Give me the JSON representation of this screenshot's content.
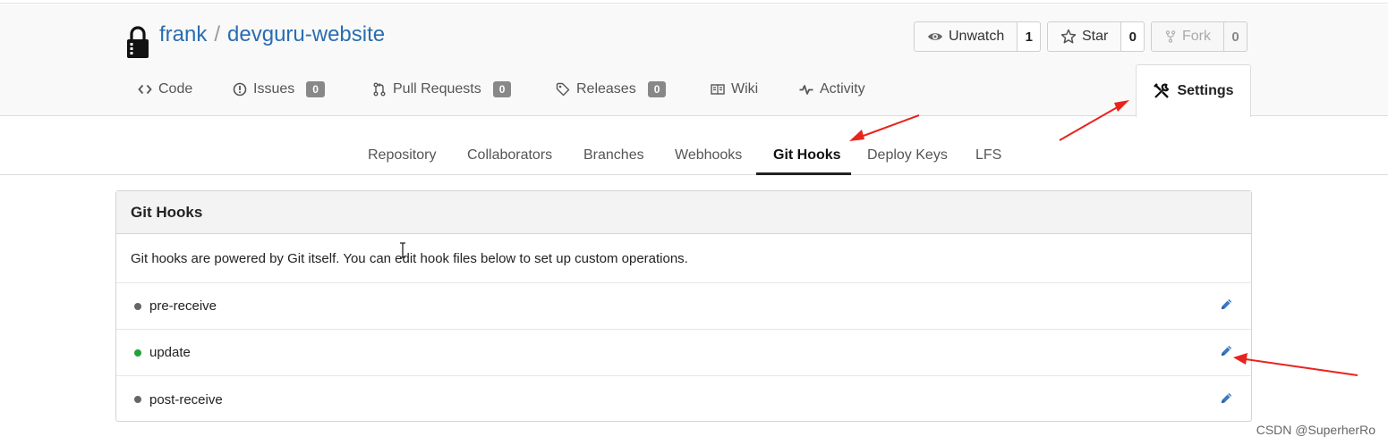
{
  "repo": {
    "owner": "frank",
    "separator": "/",
    "name": "devguru-website"
  },
  "actions": {
    "watch": {
      "label": "Unwatch",
      "count": "1"
    },
    "star": {
      "label": "Star",
      "count": "0"
    },
    "fork": {
      "label": "Fork",
      "count": "0"
    }
  },
  "tabs": [
    {
      "label": "Code",
      "icon": "code-icon"
    },
    {
      "label": "Issues",
      "icon": "issue-icon",
      "badge": "0"
    },
    {
      "label": "Pull Requests",
      "icon": "pull-request-icon",
      "badge": "0"
    },
    {
      "label": "Releases",
      "icon": "tag-icon",
      "badge": "0"
    },
    {
      "label": "Wiki",
      "icon": "book-icon"
    },
    {
      "label": "Activity",
      "icon": "pulse-icon"
    }
  ],
  "settings_tab": {
    "label": "Settings",
    "icon": "tools-icon"
  },
  "subnav": [
    {
      "label": "Repository"
    },
    {
      "label": "Collaborators"
    },
    {
      "label": "Branches"
    },
    {
      "label": "Webhooks"
    },
    {
      "label": "Git Hooks",
      "active": true
    },
    {
      "label": "Deploy Keys"
    },
    {
      "label": "LFS"
    }
  ],
  "panel": {
    "title": "Git Hooks",
    "description": "Git hooks are powered by Git itself. You can edit hook files below to set up custom operations.",
    "hooks": [
      {
        "name": "pre-receive",
        "active": false
      },
      {
        "name": "update",
        "active": true
      },
      {
        "name": "post-receive",
        "active": false
      }
    ]
  },
  "colors": {
    "link": "#2a6db0",
    "active_dot": "#21a33a",
    "inactive_dot": "#666666",
    "annotation_arrow": "#e8231d"
  },
  "watermark": "CSDN @SuperherRo"
}
